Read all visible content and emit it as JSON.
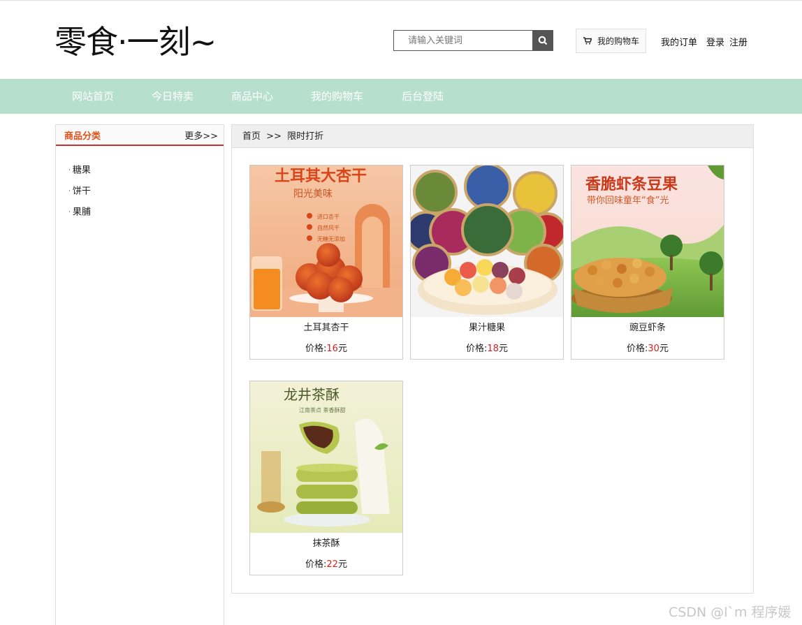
{
  "header": {
    "logo": "零食·一刻~",
    "search_placeholder": "请输入关键词",
    "cart_label": "我的购物车",
    "links": [
      "我的订单",
      "登录",
      "注册"
    ]
  },
  "nav": {
    "items": [
      "网站首页",
      "今日特卖",
      "商品中心",
      "我的购物车",
      "后台登陆"
    ]
  },
  "sidebar": {
    "title": "商品分类",
    "more": "更多>>",
    "categories": [
      "糖果",
      "饼干",
      "果脯"
    ]
  },
  "breadcrumb": {
    "home": "首页",
    "separator": ">>",
    "current": "限时打折"
  },
  "products": [
    {
      "name": "土耳其杏干",
      "price_label": "价格:",
      "price": "16",
      "unit": "元",
      "banner": "土耳其大杏干",
      "banner_sub": "阳光美味",
      "bullets": [
        "进口杏干",
        "自然风干",
        "无糖无添加"
      ]
    },
    {
      "name": "果汁糖果",
      "price_label": "价格:",
      "price": "18",
      "unit": "元"
    },
    {
      "name": "豌豆虾条",
      "price_label": "价格:",
      "price": "30",
      "unit": "元",
      "banner": "香脆虾条豆果",
      "banner_sub": "带你回味童年“食”光"
    },
    {
      "name": "抹茶酥",
      "price_label": "价格:",
      "price": "22",
      "unit": "元",
      "banner": "龙井茶酥",
      "banner_sub": "江南茶点 茶香酥甜"
    }
  ],
  "watermark": "CSDN @l`m 程序媛",
  "colors": {
    "nav_bg": "#b7dfcd",
    "accent_orange": "#e0501a",
    "price_red": "#d62020",
    "sidebar_underline": "#c7342a"
  }
}
